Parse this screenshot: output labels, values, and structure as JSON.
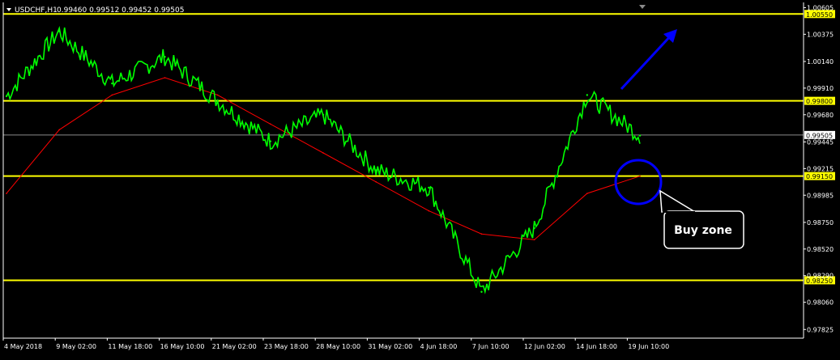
{
  "header": {
    "symbol_label": "USDCHF,H1",
    "ohlc_label": "0.99460 0.99512 0.99452 0.99505"
  },
  "colors": {
    "background": "#000000",
    "price": "#00ff00",
    "moving_average": "#ff0000",
    "levels": "#ffff00",
    "current_price_line": "#8a8a8a",
    "arrow": "#0000ff",
    "circle": "#0000ff",
    "callout_fill": "#000000",
    "callout_border": "#ffffff",
    "axis_text": "#ffffff"
  },
  "chart_data": {
    "type": "line",
    "title": "",
    "xlabel": "",
    "ylabel": "",
    "ylim": [
      0.9775,
      1.0065
    ],
    "grid": false,
    "x": [
      "4 May 2018",
      "9 May 02:00",
      "11 May 18:00",
      "16 May 10:00",
      "21 May 02:00",
      "23 May 18:00",
      "28 May 10:00",
      "31 May 02:00",
      "4 Jun 18:00",
      "7 Jun 10:00",
      "12 Jun 02:00",
      "14 Jun 18:00",
      "19 Jun 10:00"
    ],
    "x_tick_labels": [
      "4 May 2018",
      "9 May 02:00",
      "11 May 18:00",
      "16 May 10:00",
      "21 May 02:00",
      "23 May 18:00",
      "28 May 10:00",
      "31 May 02:00",
      "4 Jun 18:00",
      "7 Jun 10:00",
      "12 Jun 02:00",
      "14 Jun 18:00",
      "19 Jun 10:00"
    ],
    "y_tick_labels": [
      "1.00605",
      "1.00375",
      "1.00140",
      "0.99910",
      "0.99680",
      "0.99445",
      "0.99215",
      "0.98985",
      "0.98750",
      "0.98520",
      "0.98290",
      "0.98060",
      "0.97825"
    ],
    "series": [
      {
        "values": [
          0.9984,
          1.004,
          0.9995,
          1.0018,
          0.998,
          0.9945,
          0.9968,
          0.992,
          0.9905,
          0.9815,
          0.987,
          0.9985,
          0.995
        ]
      },
      {
        "values": [
          0.99,
          0.9955,
          0.9985,
          1.0,
          0.9985,
          0.996,
          0.9935,
          0.991,
          0.9885,
          0.9865,
          0.986,
          0.99,
          0.9915
        ]
      }
    ],
    "levels": [
      {
        "value": 1.0055,
        "label": "1.00550"
      },
      {
        "value": 0.998,
        "label": "0.99800"
      },
      {
        "value": 0.9915,
        "label": "0.99150"
      },
      {
        "value": 0.9825,
        "label": "0.98250"
      }
    ],
    "current_price": {
      "value": 0.99505,
      "label": "0.99505"
    }
  },
  "annotations": {
    "callout_text": "Buy zone"
  }
}
